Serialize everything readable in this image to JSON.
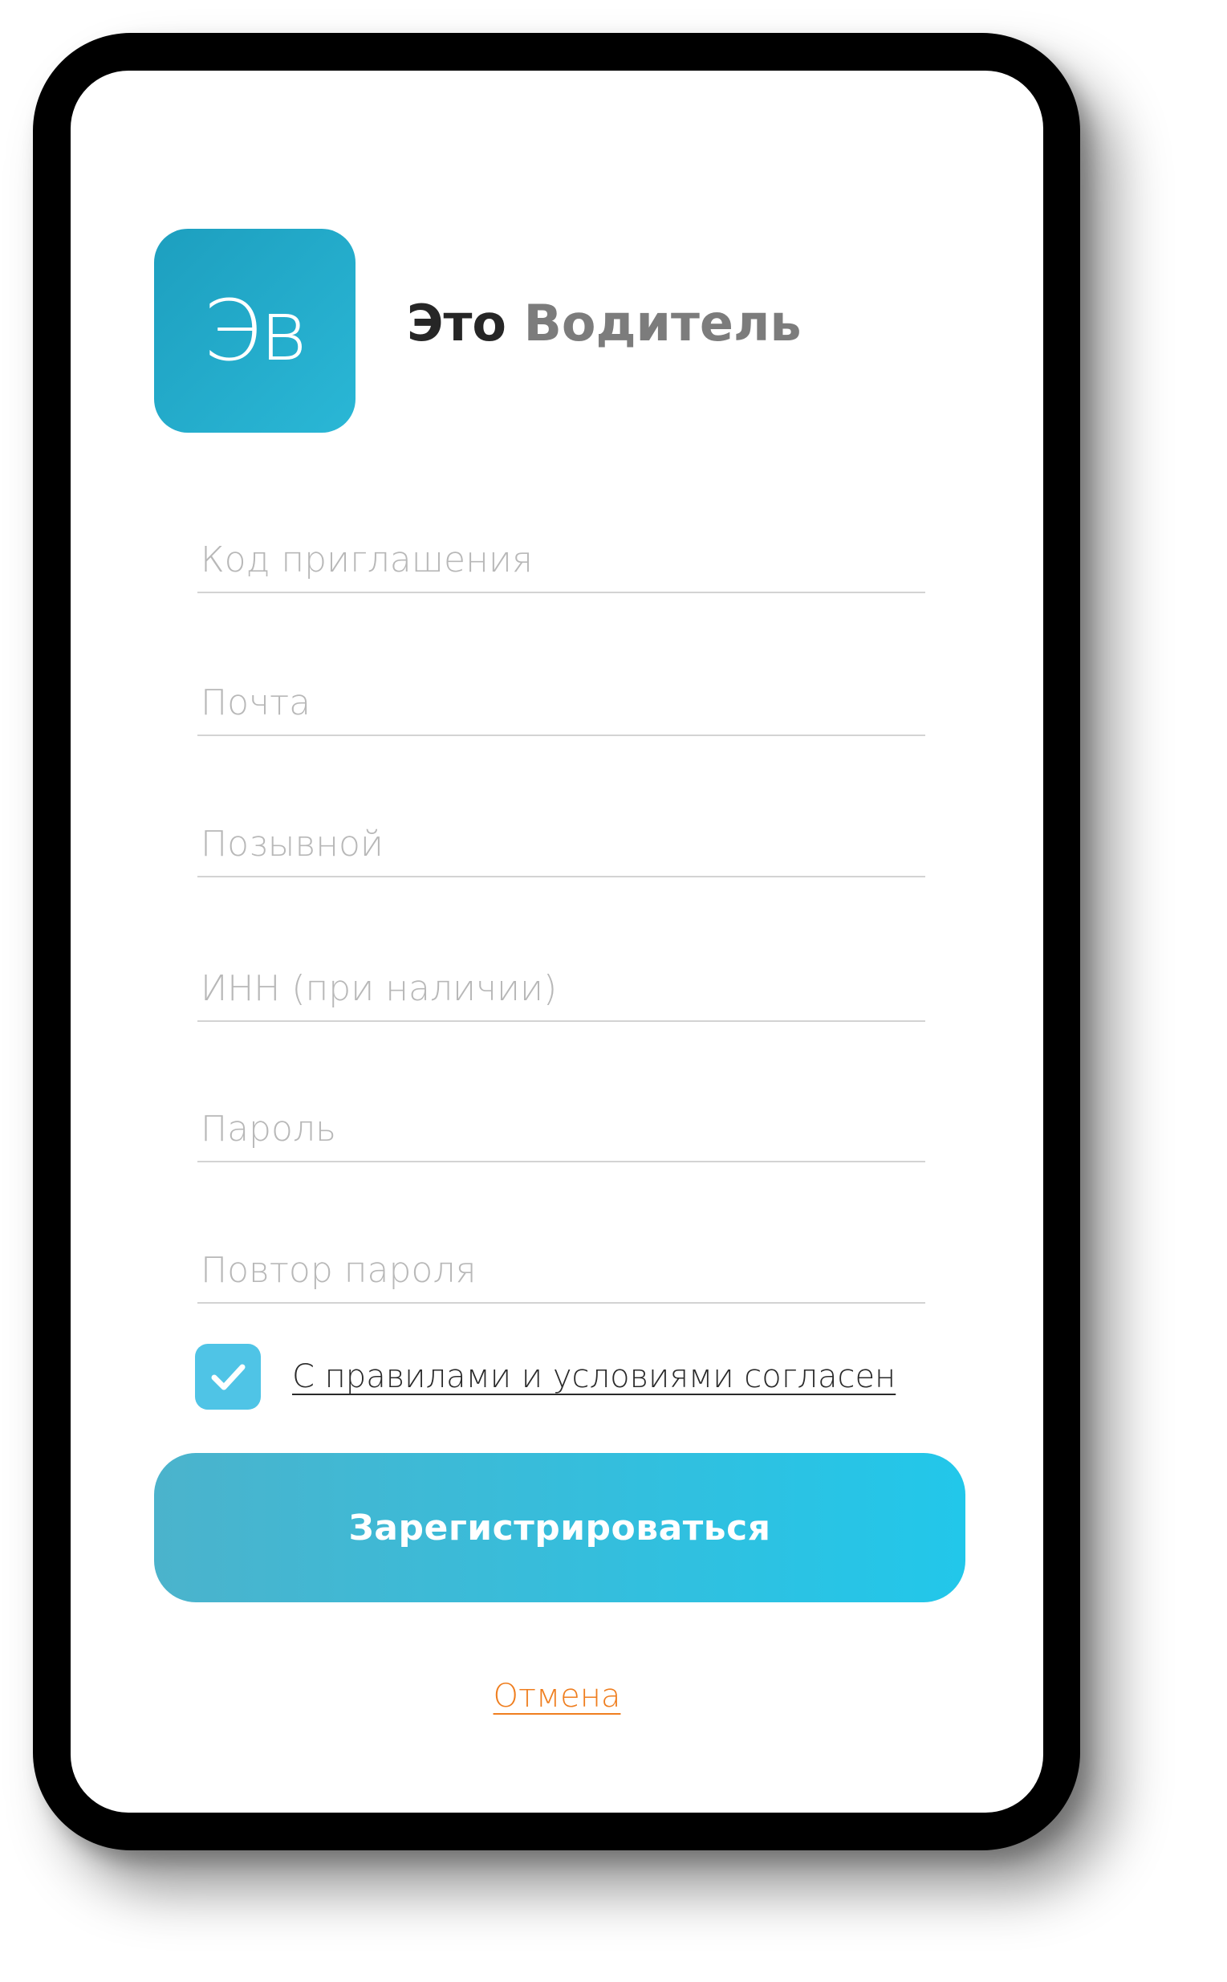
{
  "brand": {
    "logo_mark": "Эв",
    "name_word1": "Это",
    "name_word2": "Водитель",
    "accent_color": "#22b5d8"
  },
  "form": {
    "fields": [
      {
        "placeholder": "Код приглашения",
        "value": ""
      },
      {
        "placeholder": "Почта",
        "value": ""
      },
      {
        "placeholder": "Позывной",
        "value": ""
      },
      {
        "placeholder": "ИНН (при наличии)",
        "value": ""
      },
      {
        "placeholder": "Пароль",
        "value": ""
      },
      {
        "placeholder": "Повтор пароля",
        "value": ""
      }
    ],
    "agree": {
      "checked": true,
      "label": "С правилами и условиями согласен",
      "checkbox_color": "#4fc4e6"
    },
    "register_label": "Зарегистрироваться",
    "cancel_label": "Отмена",
    "cancel_color": "#ef7e1f"
  },
  "icons": {
    "checkbox": "check-icon"
  }
}
